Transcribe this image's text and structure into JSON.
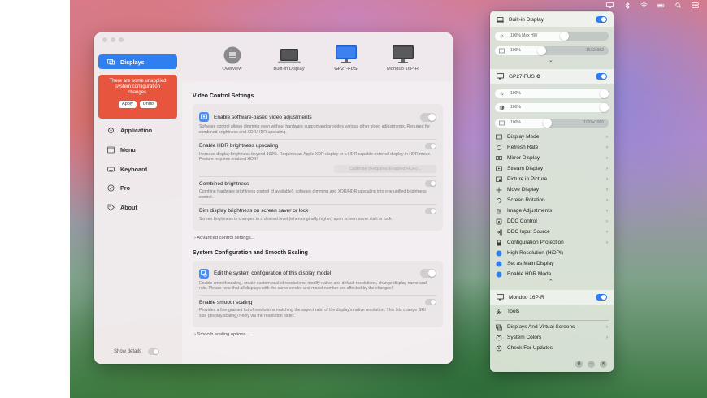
{
  "sidebar": {
    "items": [
      {
        "label": "Displays",
        "icon": "displays-icon",
        "active": true
      },
      {
        "label": "Application",
        "icon": "gear-icon"
      },
      {
        "label": "Menu",
        "icon": "menu-icon"
      },
      {
        "label": "Keyboard",
        "icon": "keyboard-icon"
      },
      {
        "label": "Pro",
        "icon": "checkmark-seal-icon"
      },
      {
        "label": "About",
        "icon": "tag-icon"
      }
    ],
    "alert": {
      "text": "There are some unapplied system configuration changes.",
      "apply_label": "Apply",
      "undo_label": "Undo",
      "color": "#e8553f"
    },
    "show_details_label": "Show details"
  },
  "display_tabs": [
    {
      "label": "Overview"
    },
    {
      "label": "Built-in Display"
    },
    {
      "label": "GP27-FUS",
      "selected": true
    },
    {
      "label": "Monduo 16P-R"
    }
  ],
  "video_control": {
    "title": "Video Control Settings",
    "software_adjust_title": "Enable software-based video adjustments",
    "software_adjust_desc": "Software control allows dimming even without hardware support and provides various other video adjustments. Required for combined brightness and XDR/HDR upscaling.",
    "hdr_title": "Enable HDR brightness upscaling",
    "hdr_desc": "Increase display brightness beyond 100%. Requires an Apple XDR display or a HDR capable external display in HDR mode. Feature requires enabled HDR!",
    "calibrate_label": "Calibrate (Requires Enabled HDR)...",
    "combined_title": "Combined brightness",
    "combined_desc": "Combine hardware brightness control (if available), software dimming and XDR/HDR upscaling into one unified brightness control.",
    "dim_title": "Dim display brightness on screen saver or lock",
    "dim_desc": "Screen brightness is changed to a desired level (when originally higher) upon screen saver start or lock.",
    "advanced_label": "Advanced control settings..."
  },
  "system_config": {
    "title": "System Configuration and Smooth Scaling",
    "edit_title": "Edit the system configuration of this display model",
    "edit_desc": "Enable smooth scaling, create custom scaled resolutions, modify native and default resolutions, change display name and role. Please note that all displays with the same vendor and model number are affected by the changes!",
    "smooth_title": "Enable smooth scaling",
    "smooth_desc": "Provides a fine-grained list of resolutions matching the aspect ratio of the display's native resolution. This lets change GUI size (display scaling) freely via the resolution slider.",
    "smooth_options_label": "Smooth scaling options..."
  },
  "panel": {
    "builtin": {
      "name": "Built-in Display",
      "slider1_label": "100% Max HW",
      "slider1_level": 0.62,
      "slider2_label": "100%",
      "slider2_right": "1512x982",
      "slider2_level": 0.4
    },
    "gp27": {
      "name": "GP27-FUS",
      "slider1_label": "100%",
      "slider1_level": 1.0,
      "slider2_label": "100%",
      "slider2_level": 1.0,
      "slider3_label": "100%",
      "slider3_right": "1920x1080",
      "slider3_level": 0.46
    },
    "menu_items": [
      {
        "label": "Display Mode",
        "icon": "display-mode-icon"
      },
      {
        "label": "Refresh Rate",
        "icon": "refresh-icon"
      },
      {
        "label": "Mirror Display",
        "icon": "mirror-icon"
      },
      {
        "label": "Stream Display",
        "icon": "stream-icon"
      },
      {
        "label": "Picture in Picture",
        "icon": "pip-icon"
      },
      {
        "label": "Move Display",
        "icon": "move-icon"
      },
      {
        "label": "Screen Rotation",
        "icon": "rotation-icon"
      },
      {
        "label": "Image Adjustments",
        "icon": "adjustments-icon"
      },
      {
        "label": "DDC Control",
        "icon": "ddc-icon"
      },
      {
        "label": "DDC Input Source",
        "icon": "input-source-icon"
      },
      {
        "label": "Configuration Protection",
        "icon": "lock-icon"
      },
      {
        "label": "High Resolution (HiDPI)",
        "icon": "hidpi-icon"
      },
      {
        "label": "Set as Main Display",
        "icon": "main-display-icon"
      },
      {
        "label": "Enable HDR Mode",
        "icon": "hdr-icon"
      }
    ],
    "monduo": {
      "name": "Monduo 16P-R"
    },
    "tools_label": "Tools",
    "bottom_items": [
      {
        "label": "Displays And Virtual Screens",
        "icon": "virtual-screens-icon"
      },
      {
        "label": "System Colors",
        "icon": "colors-icon"
      },
      {
        "label": "Check For Updates",
        "icon": "updates-icon"
      }
    ],
    "accent": "#2f7ff0"
  }
}
